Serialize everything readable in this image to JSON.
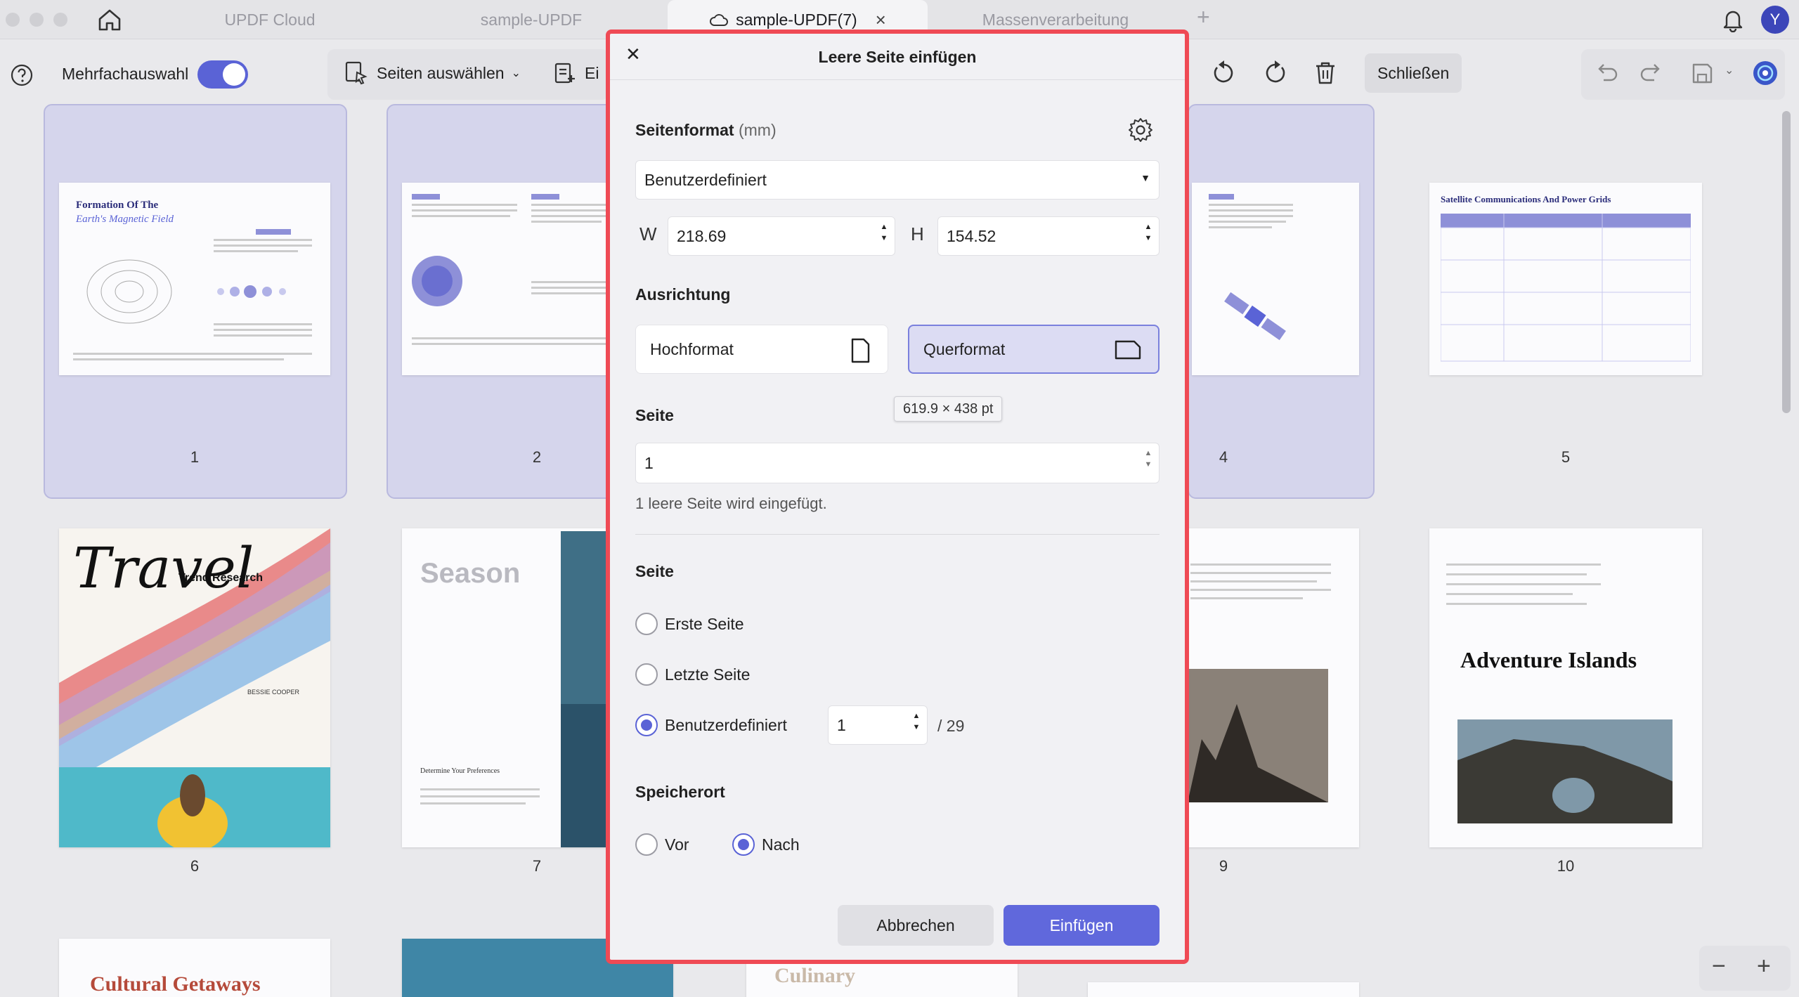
{
  "tabs": [
    {
      "label": "UPDF Cloud"
    },
    {
      "label": "sample-UPDF"
    },
    {
      "label": "sample-UPDF(7)"
    },
    {
      "label": "Massenverarbeitung"
    }
  ],
  "avatar_letter": "Y",
  "toolbar": {
    "multi_select_label": "Mehrfachauswahl",
    "select_pages_label": "Seiten auswählen",
    "insert_label": "Ei",
    "close_label": "Schließen"
  },
  "pages": {
    "numbers": [
      "1",
      "2",
      "4",
      "5",
      "6",
      "7",
      "9",
      "10"
    ],
    "page1_title": "Formation Of The",
    "page1_subtitle": "Earth's Magnetic Field",
    "page5_title": "Satellite Communications And Power Grids",
    "page6_script": "Travel",
    "page6_label": "Trend Research",
    "page6_author": "BESSIE COOPER",
    "page7_title": "Season",
    "page7_heading": "Determine Your Preferences",
    "page10_title": "Adventure Islands",
    "row3_title_a": "Cultural Getaways",
    "row3_title_b": "Culinary"
  },
  "dialog": {
    "title": "Leere Seite einfügen",
    "format_label": "Seitenformat",
    "format_unit": "(mm)",
    "format_value": "Benutzerdefiniert",
    "w_label": "W",
    "w_value": "218.69",
    "h_label": "H",
    "h_value": "154.52",
    "orientation_label": "Ausrichtung",
    "portrait_label": "Hochformat",
    "landscape_label": "Querformat",
    "tooltip": "619.9 × 438 pt",
    "page_count_label": "Seite",
    "page_count_value": "1",
    "hint": "1 leere Seite wird eingefügt.",
    "position_label": "Seite",
    "first_page": "Erste Seite",
    "last_page": "Letzte Seite",
    "custom_page": "Benutzerdefiniert",
    "custom_page_value": "1",
    "total_pages": "/ 29",
    "location_label": "Speicherort",
    "before": "Vor",
    "after": "Nach",
    "cancel": "Abbrechen",
    "insert": "Einfügen"
  },
  "colors": {
    "accent": "#5a63d6",
    "dialog_border": "#ef4a55",
    "selected_card": "#d5d5ec"
  }
}
